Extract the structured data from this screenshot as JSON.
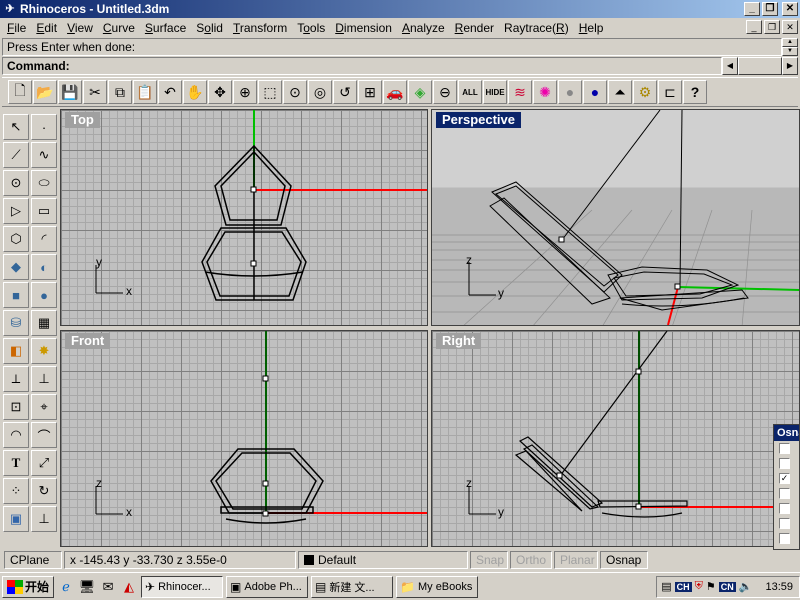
{
  "window": {
    "title": "Rhinoceros - Untitled.3dm"
  },
  "menu": [
    {
      "pre": "",
      "key": "F",
      "post": "ile"
    },
    {
      "pre": "",
      "key": "E",
      "post": "dit"
    },
    {
      "pre": "",
      "key": "V",
      "post": "iew"
    },
    {
      "pre": "",
      "key": "C",
      "post": "urve"
    },
    {
      "pre": "",
      "key": "S",
      "post": "urface"
    },
    {
      "pre": "S",
      "key": "o",
      "post": "lid"
    },
    {
      "pre": "",
      "key": "T",
      "post": "ransform"
    },
    {
      "pre": "T",
      "key": "o",
      "post": "ols"
    },
    {
      "pre": "",
      "key": "D",
      "post": "imension"
    },
    {
      "pre": "",
      "key": "A",
      "post": "nalyze"
    },
    {
      "pre": "",
      "key": "R",
      "post": "ender"
    },
    {
      "pre": "Raytrace(",
      "key": "R",
      "post": ")"
    },
    {
      "pre": "",
      "key": "H",
      "post": "elp"
    }
  ],
  "command": {
    "history": "Press Enter when done:",
    "prompt": "Command:"
  },
  "toolbar": {
    "all_label": "ALL",
    "hide_label": "HIDE"
  },
  "viewports": {
    "top": "Top",
    "perspective": "Perspective",
    "front": "Front",
    "right": "Right"
  },
  "axes": {
    "x": "x",
    "y": "y",
    "z": "z"
  },
  "osnap": {
    "title": "Osnap",
    "checked_index": 2
  },
  "status": {
    "cplane": "CPlane",
    "coords": "x -145.43  y -33.730  z 3.55e-0",
    "layer": "Default",
    "snap": "Snap",
    "ortho": "Ortho",
    "planar": "Planar",
    "osnap": "Osnap"
  },
  "taskbar": {
    "start": "开始",
    "tasks": [
      "Rhinocer...",
      "Adobe Ph...",
      "新建 文...",
      "My eBooks"
    ],
    "tray_badges": [
      "CH",
      "CN"
    ],
    "clock": "13:59"
  },
  "colors": {
    "title_active": "#0a246a",
    "x_axis": "#ff0000",
    "y_axis": "#00c000"
  }
}
